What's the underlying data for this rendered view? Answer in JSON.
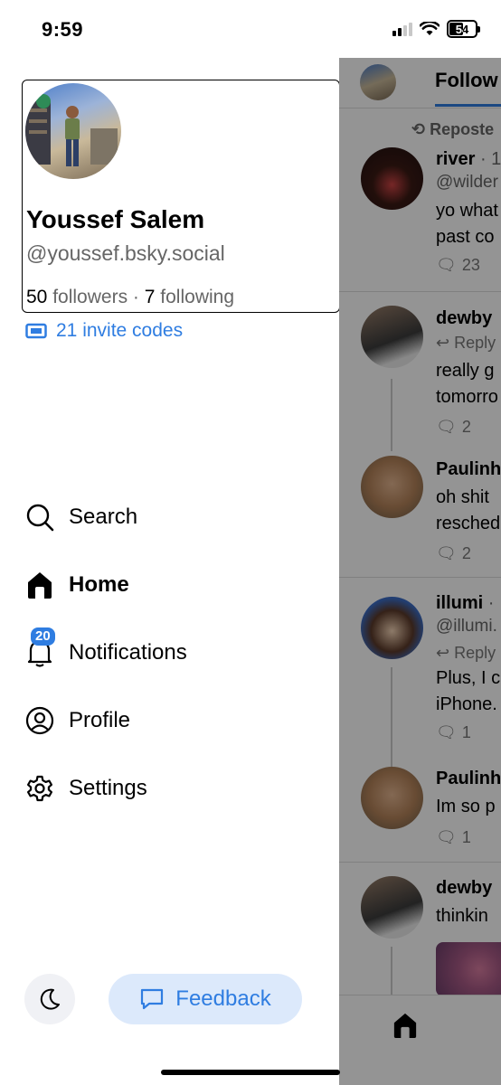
{
  "status_bar": {
    "time": "9:59",
    "battery": "54",
    "battery_level": 0.54
  },
  "profile": {
    "display_name": "Youssef Salem",
    "handle": "@youssef.bsky.social",
    "followers_count": "50",
    "followers_label": "followers",
    "separator": "·",
    "following_count": "7",
    "following_label": "following"
  },
  "invite": {
    "label": "21 invite codes"
  },
  "nav": {
    "items": [
      {
        "label": "Search",
        "icon": "search-icon"
      },
      {
        "label": "Home",
        "icon": "home-icon",
        "active": true
      },
      {
        "label": "Notifications",
        "icon": "bell-icon",
        "badge": "20"
      },
      {
        "label": "Profile",
        "icon": "user-circle-icon"
      },
      {
        "label": "Settings",
        "icon": "gear-icon"
      }
    ]
  },
  "footer": {
    "feedback_label": "Feedback",
    "theme_icon": "moon-icon"
  },
  "feed": {
    "tab_label": "Follow",
    "posts": [
      {
        "repost": "Reposte",
        "name": "river",
        "meta": "· 1",
        "handle": "@wilder",
        "text": [
          "yo what",
          "past co"
        ],
        "replies": "23"
      },
      {
        "name": "dewby",
        "reply_to": "Reply",
        "text": [
          "really g",
          "tomorro"
        ],
        "replies": "2"
      },
      {
        "name": "Paulinh",
        "text": [
          "oh shit",
          "resched"
        ],
        "replies": "2"
      },
      {
        "name": "illumi",
        "meta": "·",
        "handle": "@illumi.",
        "reply_to": "Reply",
        "text": [
          "Plus, I c",
          "iPhone."
        ],
        "replies": "1"
      },
      {
        "name": "Paulinh",
        "text": [
          "Im so p"
        ],
        "replies": "1"
      },
      {
        "name": "dewby",
        "text": [
          "thinkin"
        ]
      }
    ]
  },
  "colors": {
    "accent": "#2f7de1",
    "feedback_bg": "#dce9fb",
    "overlay": "rgba(0,0,0,0.42)"
  }
}
